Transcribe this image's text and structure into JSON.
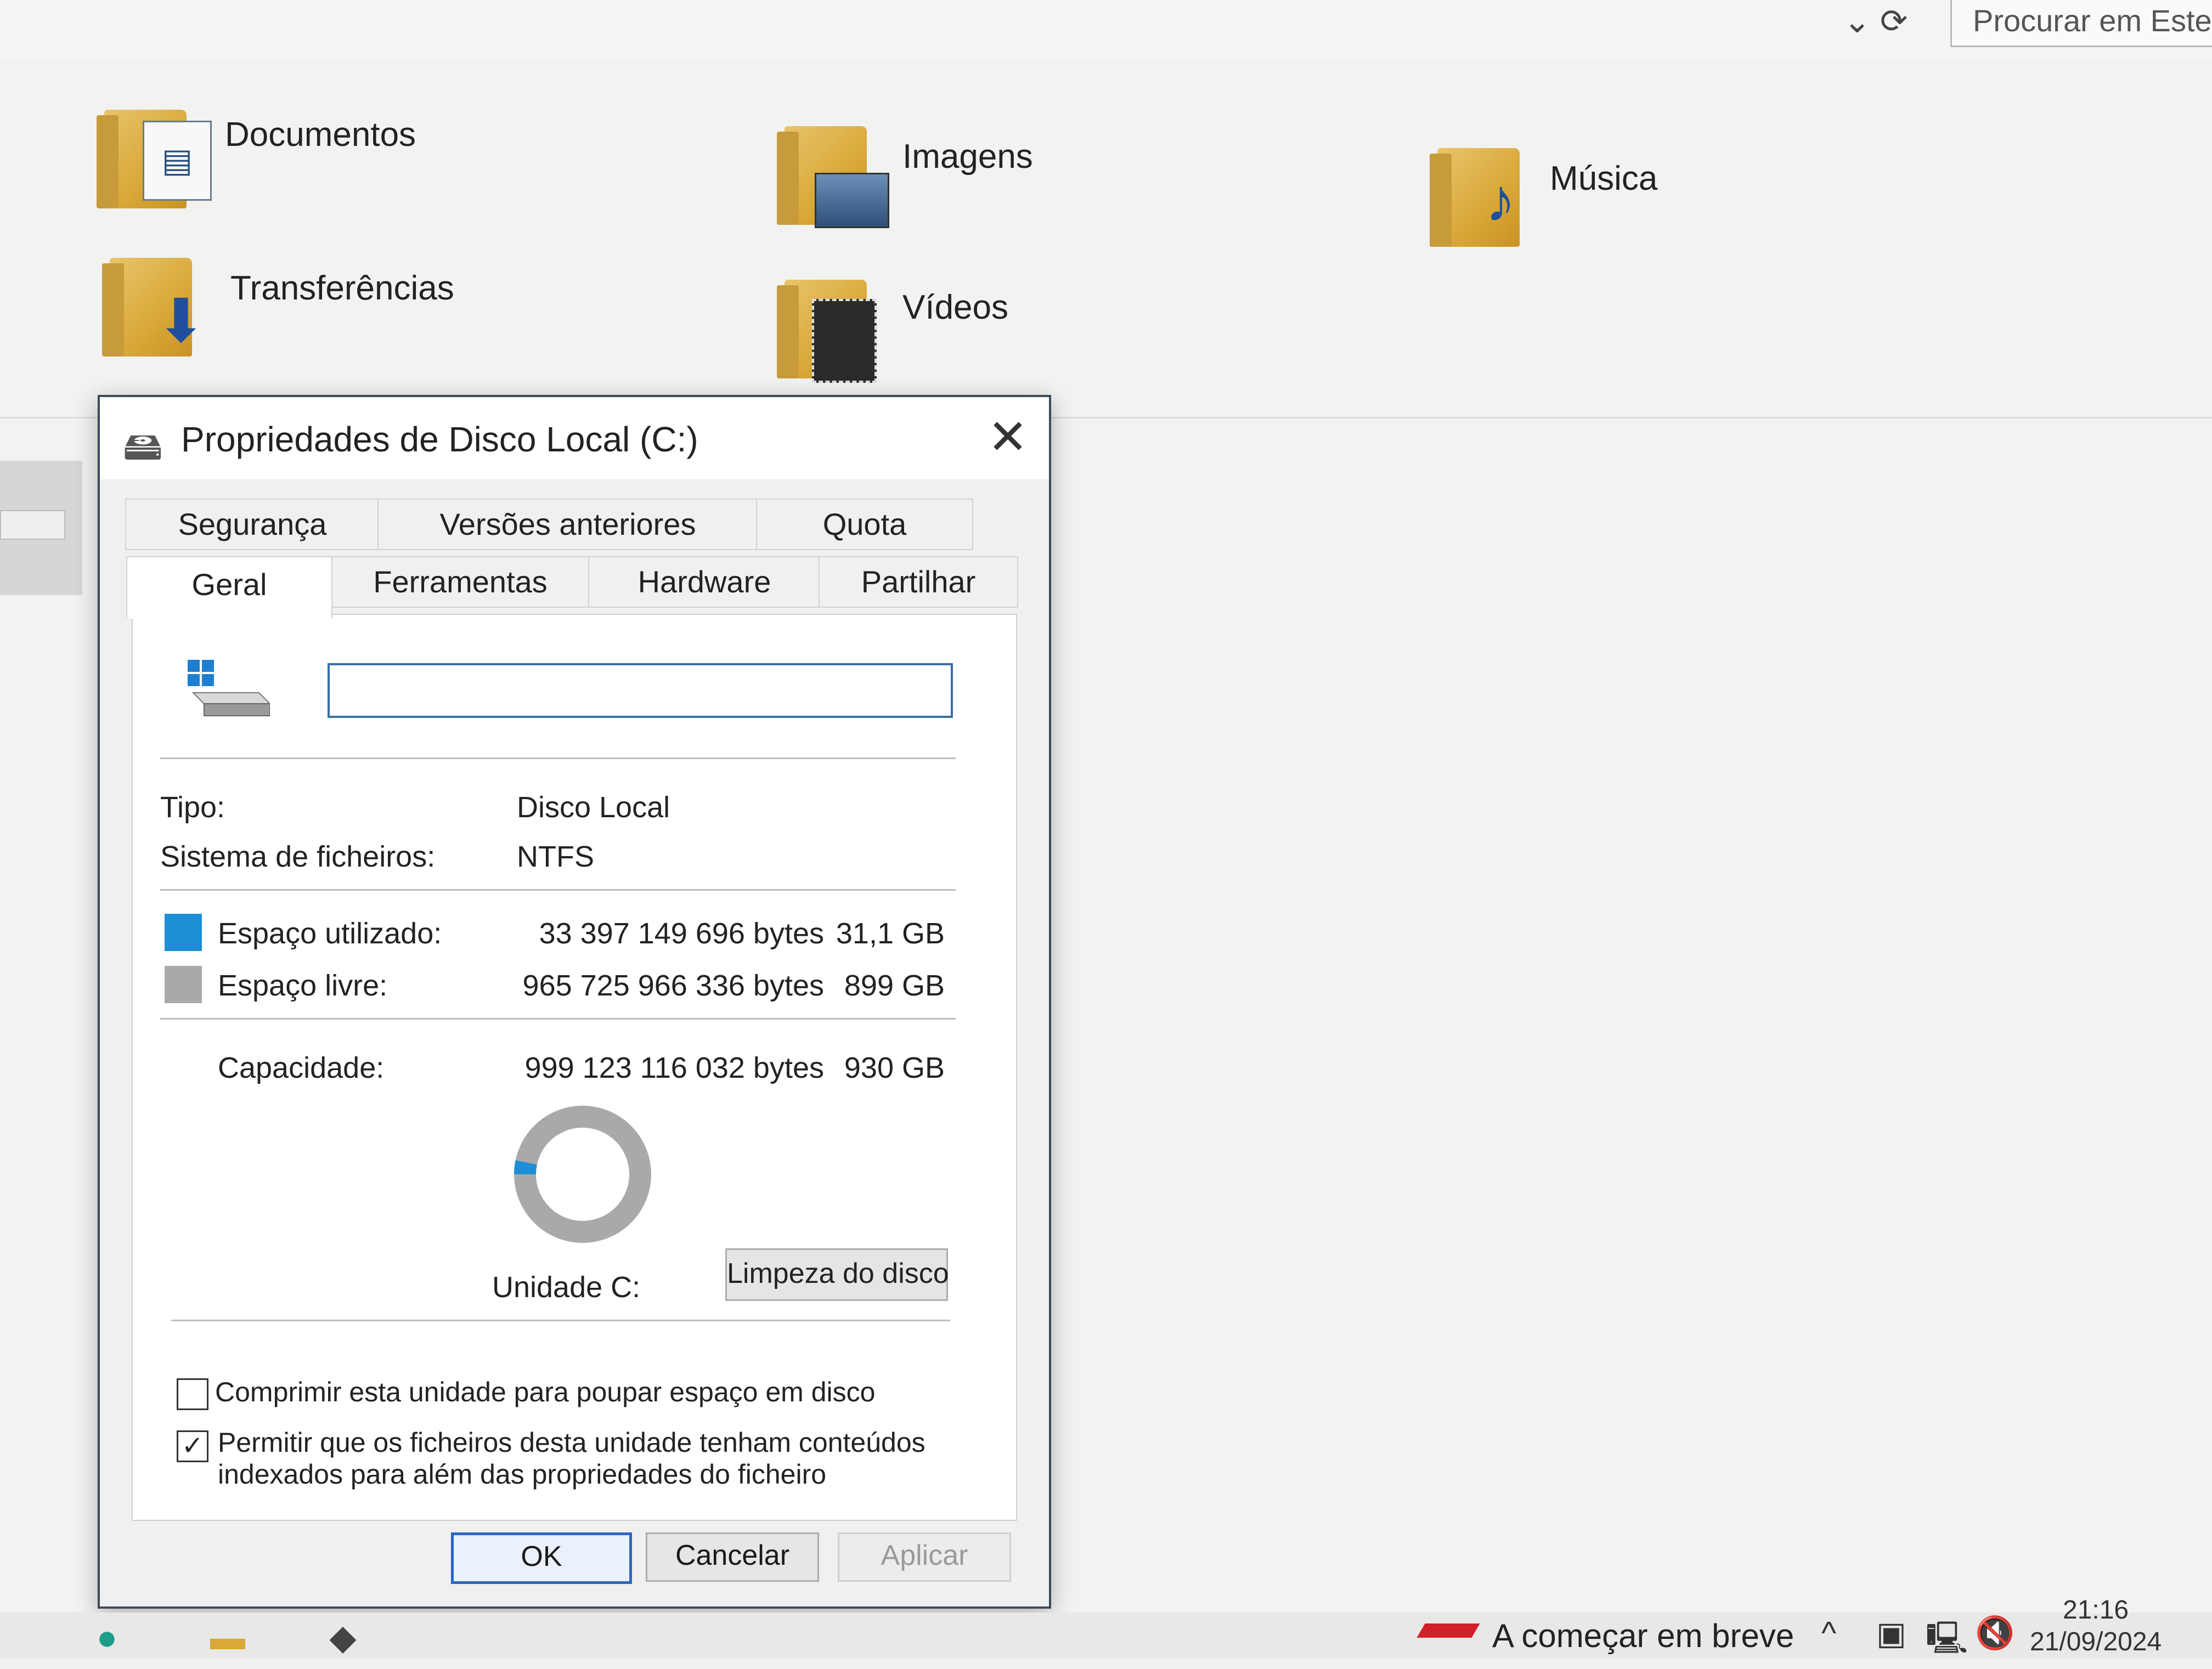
{
  "explorer": {
    "search_placeholder": "Procurar em Este P",
    "folders": [
      {
        "label": "Documentos",
        "icon": "document-icon"
      },
      {
        "label": "Imagens",
        "icon": "picture-icon"
      },
      {
        "label": "Música",
        "icon": "music-note-icon"
      },
      {
        "label": "Transferências",
        "icon": "download-arrow-icon"
      },
      {
        "label": "Vídeos",
        "icon": "film-icon"
      }
    ]
  },
  "dialog": {
    "title": "Propriedades de Disco Local (C:)",
    "tabs_back": [
      "Segurança",
      "Versões anteriores",
      "Quota"
    ],
    "tabs_front": [
      "Geral",
      "Ferramentas",
      "Hardware",
      "Partilhar"
    ],
    "active_tab": "Geral",
    "drive_name": "",
    "type_label": "Tipo:",
    "type_value": "Disco Local",
    "fs_label": "Sistema de ficheiros:",
    "fs_value": "NTFS",
    "used_label": "Espaço utilizado:",
    "used_bytes": "33 397 149 696 bytes",
    "used_size": "31,1 GB",
    "free_label": "Espaço livre:",
    "free_bytes": "965 725 966 336 bytes",
    "free_size": "899 GB",
    "capacity_label": "Capacidade:",
    "capacity_bytes": "999 123 116 032 bytes",
    "capacity_size": "930 GB",
    "used_fraction": 0.033,
    "used_color": "#1e8fd6",
    "free_color": "#a9a9a9",
    "drive_label": "Unidade C:",
    "cleanup_button": "Limpeza do disco",
    "compress_label": "Comprimir esta unidade para poupar espaço em disco",
    "compress_checked": false,
    "index_label_line1": "Permitir que os ficheiros desta unidade tenham conteúdos",
    "index_label_line2": "indexados para além das propriedades do ficheiro",
    "index_checked": true,
    "ok_button": "OK",
    "cancel_button": "Cancelar",
    "apply_button": "Aplicar"
  },
  "taskbar": {
    "notification": "A começar em breve",
    "time": "21:16",
    "date": "21/09/2024"
  }
}
